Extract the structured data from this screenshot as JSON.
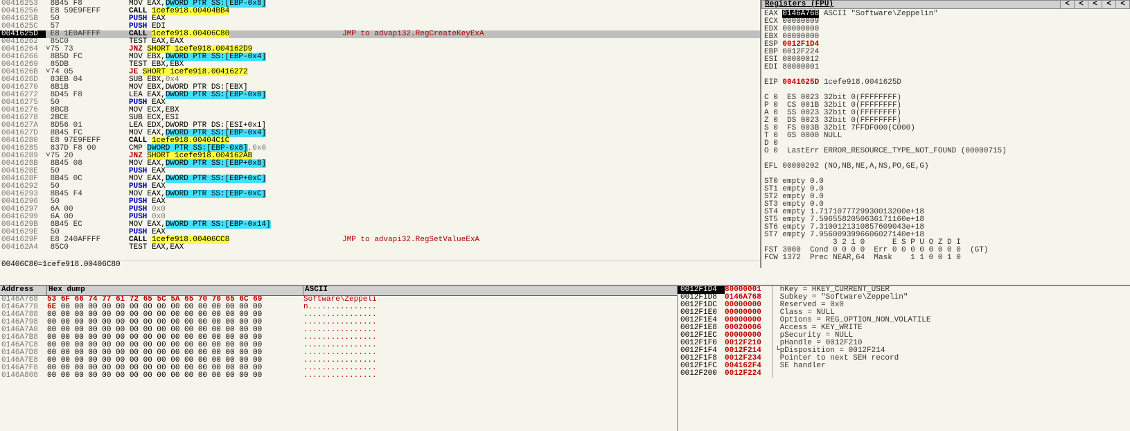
{
  "disasm": {
    "rows": [
      {
        "addr": "00416253",
        "bytes": "8B45 F8",
        "asm": "MOV EAX,",
        "seg": "DWORD PTR SS:[EBP-0x8]"
      },
      {
        "addr": "00416256",
        "bytes": "E8 59E9FEFF",
        "asm": "CALL ",
        "imm": "1cefe918.00404BB4",
        "call": true
      },
      {
        "addr": "0041625B",
        "bytes": "50",
        "asm": "PUSH EAX",
        "push": true
      },
      {
        "addr": "0041625C",
        "bytes": "57",
        "asm": "PUSH EDI",
        "push": true
      },
      {
        "addr": "0041625D",
        "bytes": "E8 1E0AFFFF",
        "asm": "CALL ",
        "imm": "1cefe918.00406C80",
        "selected": true,
        "call": true,
        "hint": "JMP to advapi32.RegCreateKeyExA"
      },
      {
        "addr": "00416262",
        "bytes": "85C0",
        "asm": "TEST EAX,EAX"
      },
      {
        "addr": "00416264",
        "bytes": "75 73",
        "jnz": true,
        "asm": "JNZ ",
        "imm": "SHORT 1cefe918.004162D9",
        "tick": true
      },
      {
        "addr": "00416266",
        "bytes": "8B5D FC",
        "asm": "MOV EBX,",
        "seg": "DWORD PTR SS:[EBP-0x4]"
      },
      {
        "addr": "00416269",
        "bytes": "85DB",
        "asm": "TEST EBX,EBX"
      },
      {
        "addr": "0041626B",
        "bytes": "74 05",
        "je": true,
        "asm": "JE ",
        "imm": "SHORT 1cefe918.00416272",
        "tick": true
      },
      {
        "addr": "0041626D",
        "bytes": "83EB 04",
        "asm": "SUB EBX,",
        "const": "0x4"
      },
      {
        "addr": "00416270",
        "bytes": "8B1B",
        "asm": "MOV EBX,DWORD PTR DS:[EBX]"
      },
      {
        "addr": "00416272",
        "bytes": "8D45 F8",
        "asm": "LEA EAX,",
        "seg": "DWORD PTR SS:[EBP-0x8]"
      },
      {
        "addr": "00416275",
        "bytes": "50",
        "asm": "PUSH EAX",
        "push": true
      },
      {
        "addr": "00416276",
        "bytes": "8BCB",
        "asm": "MOV ECX,EBX"
      },
      {
        "addr": "00416278",
        "bytes": "2BCE",
        "asm": "SUB ECX,ESI"
      },
      {
        "addr": "0041627A",
        "bytes": "8D56 01",
        "asm": "LEA EDX,DWORD PTR DS:[ESI+0x1]"
      },
      {
        "addr": "0041627D",
        "bytes": "8B45 FC",
        "asm": "MOV EAX,",
        "seg": "DWORD PTR SS:[EBP-0x4]"
      },
      {
        "addr": "00416280",
        "bytes": "E8 97E9FEFF",
        "asm": "CALL ",
        "imm": "1cefe918.00404C1C",
        "call": true
      },
      {
        "addr": "00416285",
        "bytes": "837D F8 00",
        "asm": "CMP ",
        "seg": "DWORD PTR SS:[EBP-0x8]",
        "const": ",0x0"
      },
      {
        "addr": "00416289",
        "bytes": "75 20",
        "jnz": true,
        "asm": "JNZ ",
        "imm": "SHORT 1cefe918.004162AB",
        "tick": true
      },
      {
        "addr": "0041628B",
        "bytes": "8B45 08",
        "asm": "MOV EAX,",
        "seg": "DWORD PTR SS:[EBP+0x8]"
      },
      {
        "addr": "0041628E",
        "bytes": "50",
        "asm": "PUSH EAX",
        "push": true
      },
      {
        "addr": "0041628F",
        "bytes": "8B45 0C",
        "asm": "MOV EAX,",
        "seg": "DWORD PTR SS:[EBP+0xC]"
      },
      {
        "addr": "00416292",
        "bytes": "50",
        "asm": "PUSH EAX",
        "push": true
      },
      {
        "addr": "00416293",
        "bytes": "8B45 F4",
        "asm": "MOV EAX,",
        "seg": "DWORD PTR SS:[EBP-0xC]"
      },
      {
        "addr": "00416296",
        "bytes": "50",
        "asm": "PUSH EAX",
        "push": true
      },
      {
        "addr": "00416297",
        "bytes": "6A 00",
        "asm": "PUSH ",
        "const": "0x0",
        "push": true
      },
      {
        "addr": "00416299",
        "bytes": "6A 00",
        "asm": "PUSH ",
        "const": "0x0",
        "push": true
      },
      {
        "addr": "0041629B",
        "bytes": "8B45 EC",
        "asm": "MOV EAX,",
        "seg": "DWORD PTR SS:[EBP-0x14]"
      },
      {
        "addr": "0041629E",
        "bytes": "50",
        "asm": "PUSH EAX",
        "push": true
      },
      {
        "addr": "0041629F",
        "bytes": "E8 240AFFFF",
        "asm": "CALL ",
        "imm": "1cefe918.00406CC8",
        "call": true,
        "hint": "JMP to advapi32.RegSetValueExA"
      },
      {
        "addr": "004162A4",
        "bytes": "85C0",
        "asm": "TEST EAX,EAX"
      }
    ],
    "status": "00406C80=1cefe918.00406C80"
  },
  "registers": {
    "title": "Registers (FPU)",
    "lines": [
      {
        "t": "EAX ",
        "hl": "0146A768",
        "s": " ASCII \"Software\\Zeppelin\""
      },
      {
        "t": "ECX 00000009"
      },
      {
        "t": "EDX 00000000"
      },
      {
        "t": "EBX 00000000"
      },
      {
        "t": "ESP ",
        "red": "0012F1D4"
      },
      {
        "t": "EBP ",
        "v": "0012F224"
      },
      {
        "t": "ESI 00000012"
      },
      {
        "t": "EDI 80000001"
      },
      {
        "blank": true
      },
      {
        "t": "EIP ",
        "red": "0041625D",
        "s": " 1cefe918.0041625D"
      },
      {
        "blank": true
      },
      {
        "t": "C 0  ES 0023 32bit 0(FFFFFFFF)"
      },
      {
        "t": "P 0  CS 001B 32bit 0(FFFFFFFF)"
      },
      {
        "t": "A 0  SS 0023 32bit 0(FFFFFFFF)"
      },
      {
        "t": "Z 0  DS 0023 32bit 0(FFFFFFFF)"
      },
      {
        "t": "S 0  FS 003B 32bit 7FFDF000(C000)"
      },
      {
        "t": "T 0  GS 0000 NULL"
      },
      {
        "t": "D 0"
      },
      {
        "t": "O 0  LastErr ERROR_RESOURCE_TYPE_NOT_FOUND (00000715)"
      },
      {
        "blank": true
      },
      {
        "t": "EFL 00000202 (NO,NB,NE,A,NS,PO,GE,G)"
      },
      {
        "blank": true
      },
      {
        "t": "ST0 empty 0.0"
      },
      {
        "t": "ST1 empty 0.0"
      },
      {
        "t": "ST2 empty 0.0"
      },
      {
        "t": "ST3 empty 0.0"
      },
      {
        "t": "ST4 empty 1.7171077729930013200e+18"
      },
      {
        "t": "ST5 empty 7.5965582050636171160e+18"
      },
      {
        "t": "ST6 empty 7.3100121310857609043e+18"
      },
      {
        "t": "ST7 empty 7.9560093996606027140e+18"
      },
      {
        "t": "               3 2 1 0      E S P U O Z D I"
      },
      {
        "t": "FST 3000  Cond 0 0 0 0  Err 0 0 0 0 0 0 0 0  (GT)"
      },
      {
        "t": "FCW 1372  Prec NEAR,64  Mask    1 1 0 0 1 0"
      }
    ]
  },
  "dump": {
    "headers": {
      "addr": "Address",
      "hex": "Hex dump",
      "ascii": "ASCII"
    },
    "rows": [
      {
        "addr": "0146A768",
        "hex": [
          {
            "b": "53",
            "r": 1
          },
          {
            "b": "6F",
            "r": 1
          },
          {
            "b": "66",
            "r": 1
          },
          {
            "b": "74",
            "r": 1
          },
          {
            "b": "77",
            "r": 1
          },
          {
            "b": "61",
            "r": 1
          },
          {
            "b": "72",
            "r": 1
          },
          {
            "b": "65",
            "r": 1
          },
          {
            "b": "5C",
            "r": 1
          },
          {
            "b": "5A",
            "r": 1
          },
          {
            "b": "65",
            "r": 1
          },
          {
            "b": "70",
            "r": 1
          },
          {
            "b": "70",
            "r": 1
          },
          {
            "b": "65",
            "r": 1
          },
          {
            "b": "6C",
            "r": 1
          },
          {
            "b": "69",
            "r": 1
          }
        ],
        "ascii": "Software\\Zeppeli"
      },
      {
        "addr": "0146A778",
        "hex": [
          {
            "b": "6E",
            "r": 1
          },
          {
            "b": "00"
          },
          {
            "b": "00"
          },
          {
            "b": "00"
          },
          {
            "b": "00"
          },
          {
            "b": "00"
          },
          {
            "b": "00"
          },
          {
            "b": "00"
          },
          {
            "b": "00"
          },
          {
            "b": "00"
          },
          {
            "b": "00"
          },
          {
            "b": "00"
          },
          {
            "b": "00"
          },
          {
            "b": "00"
          },
          {
            "b": "00"
          },
          {
            "b": "00"
          }
        ],
        "ascii": "n..............."
      },
      {
        "addr": "0146A788",
        "hex": [
          {
            "b": "00"
          },
          {
            "b": "00"
          },
          {
            "b": "00"
          },
          {
            "b": "00"
          },
          {
            "b": "00"
          },
          {
            "b": "00"
          },
          {
            "b": "00"
          },
          {
            "b": "00"
          },
          {
            "b": "00"
          },
          {
            "b": "00"
          },
          {
            "b": "00"
          },
          {
            "b": "00"
          },
          {
            "b": "00"
          },
          {
            "b": "00"
          },
          {
            "b": "00"
          },
          {
            "b": "00"
          }
        ],
        "ascii": "................"
      },
      {
        "addr": "0146A798",
        "hex": [
          {
            "b": "00"
          },
          {
            "b": "00"
          },
          {
            "b": "00"
          },
          {
            "b": "00"
          },
          {
            "b": "00"
          },
          {
            "b": "00"
          },
          {
            "b": "00"
          },
          {
            "b": "00"
          },
          {
            "b": "00"
          },
          {
            "b": "00"
          },
          {
            "b": "00"
          },
          {
            "b": "00"
          },
          {
            "b": "00"
          },
          {
            "b": "00"
          },
          {
            "b": "00"
          },
          {
            "b": "00"
          }
        ],
        "ascii": "................"
      },
      {
        "addr": "0146A7A8",
        "hex": [
          {
            "b": "00"
          },
          {
            "b": "00"
          },
          {
            "b": "00"
          },
          {
            "b": "00"
          },
          {
            "b": "00"
          },
          {
            "b": "00"
          },
          {
            "b": "00"
          },
          {
            "b": "00"
          },
          {
            "b": "00"
          },
          {
            "b": "00"
          },
          {
            "b": "00"
          },
          {
            "b": "00"
          },
          {
            "b": "00"
          },
          {
            "b": "00"
          },
          {
            "b": "00"
          },
          {
            "b": "00"
          }
        ],
        "ascii": "................"
      },
      {
        "addr": "0146A7B8",
        "hex": [
          {
            "b": "00"
          },
          {
            "b": "00"
          },
          {
            "b": "00"
          },
          {
            "b": "00"
          },
          {
            "b": "00"
          },
          {
            "b": "00"
          },
          {
            "b": "00"
          },
          {
            "b": "00"
          },
          {
            "b": "00"
          },
          {
            "b": "00"
          },
          {
            "b": "00"
          },
          {
            "b": "00"
          },
          {
            "b": "00"
          },
          {
            "b": "00"
          },
          {
            "b": "00"
          },
          {
            "b": "00"
          }
        ],
        "ascii": "................"
      },
      {
        "addr": "0146A7C8",
        "hex": [
          {
            "b": "00"
          },
          {
            "b": "00"
          },
          {
            "b": "00"
          },
          {
            "b": "00"
          },
          {
            "b": "00"
          },
          {
            "b": "00"
          },
          {
            "b": "00"
          },
          {
            "b": "00"
          },
          {
            "b": "00"
          },
          {
            "b": "00"
          },
          {
            "b": "00"
          },
          {
            "b": "00"
          },
          {
            "b": "00"
          },
          {
            "b": "00"
          },
          {
            "b": "00"
          },
          {
            "b": "00"
          }
        ],
        "ascii": "................"
      },
      {
        "addr": "0146A7D8",
        "hex": [
          {
            "b": "00"
          },
          {
            "b": "00"
          },
          {
            "b": "00"
          },
          {
            "b": "00"
          },
          {
            "b": "00"
          },
          {
            "b": "00"
          },
          {
            "b": "00"
          },
          {
            "b": "00"
          },
          {
            "b": "00"
          },
          {
            "b": "00"
          },
          {
            "b": "00"
          },
          {
            "b": "00"
          },
          {
            "b": "00"
          },
          {
            "b": "00"
          },
          {
            "b": "00"
          },
          {
            "b": "00"
          }
        ],
        "ascii": "................"
      },
      {
        "addr": "0146A7E8",
        "hex": [
          {
            "b": "00"
          },
          {
            "b": "00"
          },
          {
            "b": "00"
          },
          {
            "b": "00"
          },
          {
            "b": "00"
          },
          {
            "b": "00"
          },
          {
            "b": "00"
          },
          {
            "b": "00"
          },
          {
            "b": "00"
          },
          {
            "b": "00"
          },
          {
            "b": "00"
          },
          {
            "b": "00"
          },
          {
            "b": "00"
          },
          {
            "b": "00"
          },
          {
            "b": "00"
          },
          {
            "b": "00"
          }
        ],
        "ascii": "................"
      },
      {
        "addr": "0146A7F8",
        "hex": [
          {
            "b": "00"
          },
          {
            "b": "00"
          },
          {
            "b": "00"
          },
          {
            "b": "00"
          },
          {
            "b": "00"
          },
          {
            "b": "00"
          },
          {
            "b": "00"
          },
          {
            "b": "00"
          },
          {
            "b": "00"
          },
          {
            "b": "00"
          },
          {
            "b": "00"
          },
          {
            "b": "00"
          },
          {
            "b": "00"
          },
          {
            "b": "00"
          },
          {
            "b": "00"
          },
          {
            "b": "00"
          }
        ],
        "ascii": "................"
      },
      {
        "addr": "0146A808",
        "hex": [
          {
            "b": "00"
          },
          {
            "b": "00"
          },
          {
            "b": "00"
          },
          {
            "b": "00"
          },
          {
            "b": "00"
          },
          {
            "b": "00"
          },
          {
            "b": "00"
          },
          {
            "b": "00"
          },
          {
            "b": "00"
          },
          {
            "b": "00"
          },
          {
            "b": "00"
          },
          {
            "b": "00"
          },
          {
            "b": "00"
          },
          {
            "b": "00"
          },
          {
            "b": "00"
          },
          {
            "b": "00"
          }
        ],
        "ascii": "................"
      }
    ]
  },
  "stack": {
    "rows": [
      {
        "addr": "0012F1D4",
        "val": "80000001",
        "top": true,
        "info": "hKey = HKEY_CURRENT_USER"
      },
      {
        "addr": "0012F1D8",
        "val": "0146A768",
        "red": true,
        "info": "Subkey = \"Software\\Zeppelin\""
      },
      {
        "addr": "0012F1DC",
        "val": "00000000",
        "red": true,
        "info": "Reserved = 0x0"
      },
      {
        "addr": "0012F1E0",
        "val": "00000000",
        "red": true,
        "info": "Class = NULL"
      },
      {
        "addr": "0012F1E4",
        "val": "00000000",
        "red": true,
        "info": "Options = REG_OPTION_NON_VOLATILE"
      },
      {
        "addr": "0012F1E8",
        "val": "00020006",
        "red": true,
        "info": "Access = KEY_WRITE"
      },
      {
        "addr": "0012F1EC",
        "val": "00000000",
        "red": true,
        "info": "pSecurity = NULL"
      },
      {
        "addr": "0012F1F0",
        "val": "0012F210",
        "red": true,
        "info": "pHandle = 0012F210"
      },
      {
        "addr": "0012F1F4",
        "val": "0012F214",
        "red": true,
        "info": "pDisposition = 0012F214",
        "mark": true
      },
      {
        "addr": "0012F1F8",
        "val": "0012F234",
        "red": true,
        "info": "Pointer to next SEH record"
      },
      {
        "addr": "0012F1FC",
        "val": "004162F4",
        "red": true,
        "info": "SE handler"
      },
      {
        "addr": "0012F200",
        "val": "0012F224",
        "red": true,
        "info": ""
      }
    ]
  }
}
